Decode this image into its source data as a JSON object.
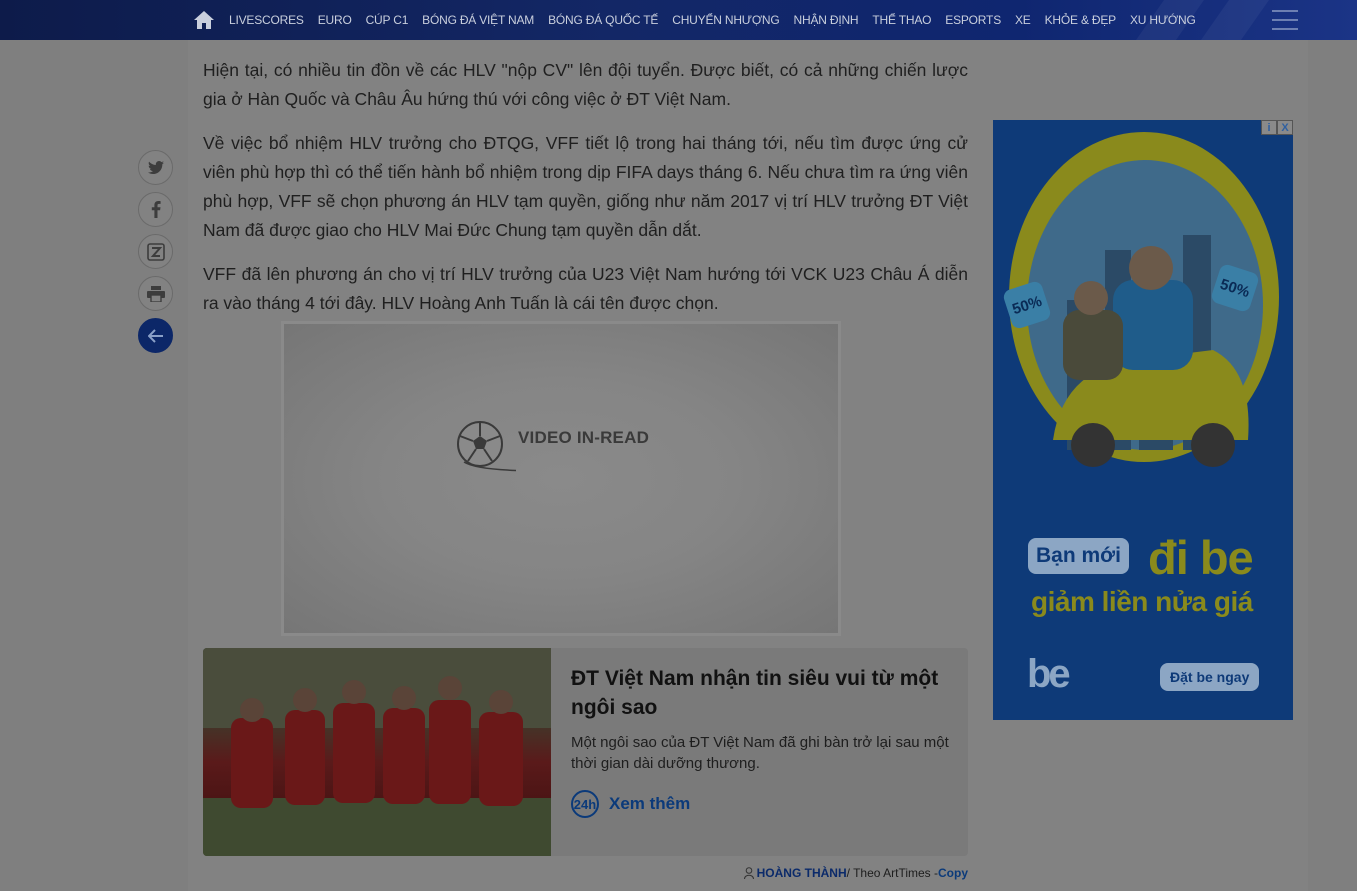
{
  "nav": {
    "items": [
      "LIVESCORES",
      "EURO",
      "CÚP C1",
      "BÓNG ĐÁ VIỆT NAM",
      "BÓNG ĐÁ QUỐC TẾ",
      "CHUYỂN NHƯỢNG",
      "NHẬN ĐỊNH",
      "THỂ THAO",
      "ESPORTS",
      "XE",
      "KHỎE & ĐẸP",
      "XU HƯỚNG"
    ]
  },
  "article": {
    "paragraphs": [
      "Hiện tại, có nhiều tin đồn về các HLV \"nộp CV\" lên đội tuyển. Được biết, có cả những chiến lược gia ở Hàn Quốc và Châu Âu hứng thú với công việc ở ĐT Việt Nam.",
      "Về việc bổ nhiệm HLV trưởng cho ĐTQG, VFF tiết lộ trong hai tháng tới, nếu tìm được ứng cử viên phù hợp thì có thể tiến hành bổ nhiệm trong dịp FIFA days tháng 6. Nếu chưa tìm ra ứng viên phù hợp, VFF sẽ chọn phương án HLV tạm quyền, giống như năm 2017 vị trí HLV trưởng ĐT Việt Nam đã được giao cho HLV Mai Đức Chung tạm quyền dẫn dắt.",
      "VFF đã lên phương án cho vị trí HLV trưởng của U23 Việt Nam hướng tới VCK U23 Châu Á diễn ra vào tháng 4 tới đây. HLV Hoàng Anh Tuấn là cái tên được chọn."
    ]
  },
  "share": {
    "icons": [
      "twitter-icon",
      "facebook-icon",
      "zalo-icon",
      "print-icon",
      "back-arrow-icon"
    ]
  },
  "video": {
    "label": "VIDEO IN-READ"
  },
  "related": {
    "title": "ĐT Việt Nam nhận tin siêu vui từ một ngôi sao",
    "description": "Một ngôi sao của ĐT Việt Nam đã ghi bàn trở lại sau một thời gian dài dưỡng thương.",
    "more_icon_text": "24h",
    "more_label": "Xem thêm"
  },
  "credit": {
    "author": "HOÀNG THÀNH",
    "source": " / Theo ArtTimes - ",
    "copy": "Copy"
  },
  "ad": {
    "badge": "50%",
    "pill": "Bạn mới",
    "headline": "đi be",
    "subline": "giảm liền nửa giá",
    "logo": "be",
    "cta": "Đặt be ngay",
    "info": "i",
    "close": "X"
  },
  "colors": {
    "nav_bg": "#132766",
    "accent": "#0b3a7a",
    "ad_yellow": "#8a8a1c"
  }
}
